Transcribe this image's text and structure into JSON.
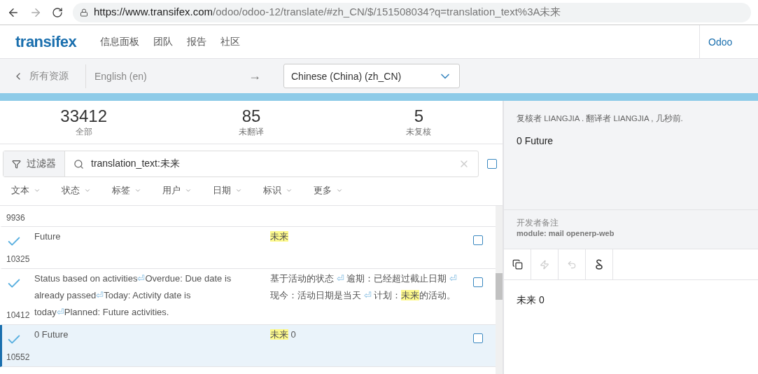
{
  "browser": {
    "url_host": "https://www.transifex.com",
    "url_path": "/odoo/odoo-12/translate/#zh_CN/$/151508034?q=translation_text%3A未来"
  },
  "header": {
    "logo": "transifex",
    "nav": [
      "信息面板",
      "团队",
      "报告",
      "社区"
    ],
    "org": "Odoo"
  },
  "subbar": {
    "back": "所有资源",
    "source_lang": "English (en)",
    "arrow": "→",
    "target_lang": "Chinese (China) (zh_CN)"
  },
  "stats": [
    {
      "value": "33412",
      "label": "全部"
    },
    {
      "value": "85",
      "label": "未翻译"
    },
    {
      "value": "5",
      "label": "未复核"
    }
  ],
  "filter": {
    "button": "过滤器",
    "query": "translation_text:未来",
    "select_all_checked": false
  },
  "facets": [
    "文本",
    "状态",
    "标签",
    "用户",
    "日期",
    "标识",
    "更多"
  ],
  "rows": [
    {
      "id": "9936",
      "selected": false
    },
    {
      "id": "10325",
      "selected": false,
      "reviewed": true,
      "checked": false,
      "source": [
        {
          "kind": "text",
          "text": "Future"
        }
      ],
      "translation": [
        {
          "kind": "highlight",
          "text": "未来"
        }
      ]
    },
    {
      "id": "10412",
      "selected": false,
      "reviewed": true,
      "checked": false,
      "source": [
        {
          "kind": "text",
          "text": "Status based on activities"
        },
        {
          "kind": "mark",
          "text": "⏎"
        },
        {
          "kind": "text",
          "text": "Overdue: Due date is already passed"
        },
        {
          "kind": "mark",
          "text": "⏎"
        },
        {
          "kind": "text",
          "text": "Today: Activity date is today"
        },
        {
          "kind": "mark",
          "text": "⏎"
        },
        {
          "kind": "text",
          "text": "Planned: Future activities."
        }
      ],
      "translation": [
        {
          "kind": "text",
          "text": "基于活动的状态 "
        },
        {
          "kind": "mark",
          "text": "⏎"
        },
        {
          "kind": "text",
          "text": " 逾期：已经超过截止日期 "
        },
        {
          "kind": "mark",
          "text": "⏎"
        },
        {
          "kind": "text",
          "text": " 现今：活动日期是当天 "
        },
        {
          "kind": "mark",
          "text": "⏎"
        },
        {
          "kind": "text",
          "text": " 计划："
        },
        {
          "kind": "highlight",
          "text": "未来"
        },
        {
          "kind": "text",
          "text": "的活动。"
        }
      ]
    },
    {
      "id": "10552",
      "selected": true,
      "reviewed": true,
      "checked": false,
      "source": [
        {
          "kind": "text",
          "text": "0 Future"
        }
      ],
      "translation": [
        {
          "kind": "highlight",
          "text": "未来"
        },
        {
          "kind": "text",
          "text": " 0"
        }
      ]
    }
  ],
  "details": {
    "history": "复核者 LIANGJIA . 翻译者 LIANGJIA , 几秒前.",
    "current": "0 Future",
    "notes_title": "开发者备注",
    "notes_body": "module: mail openerp-web",
    "tools": [
      {
        "kind": "copy",
        "disabled": false
      },
      {
        "kind": "bolt",
        "disabled": true
      },
      {
        "kind": "undo",
        "disabled": true
      },
      {
        "kind": "ampersand",
        "disabled": false
      }
    ],
    "editor_text": "未来 0"
  }
}
